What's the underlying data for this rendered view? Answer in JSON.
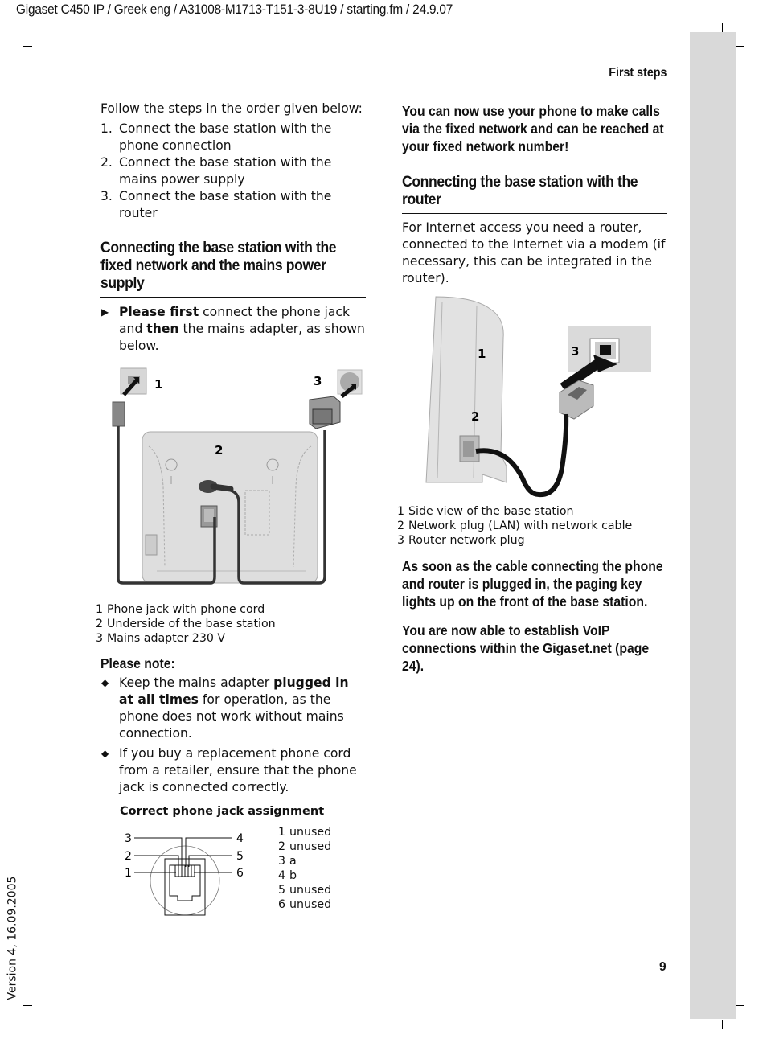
{
  "header": {
    "doc_line": "Gigaset C450 IP / Greek eng / A31008-M1713-T151-3-8U19 / starting.fm / 24.9.07",
    "running_head": "First steps",
    "page_number": "9",
    "version": "Version 4, 16.09.2005"
  },
  "left": {
    "intro": "Follow the steps in the order given below:",
    "steps": [
      {
        "num": "1.",
        "text": "Connect the base station with the phone connection"
      },
      {
        "num": "2.",
        "text": "Connect the base station with the mains power supply"
      },
      {
        "num": "3.",
        "text": "Connect the base station with the router"
      }
    ],
    "section_heading": "Connecting the base station with the fixed network and the mains power supply",
    "instruction": {
      "marker": "▶",
      "bold1": "Please first",
      "text1": " connect the phone jack and ",
      "bold2": "then",
      "text2": " the mains adapter, as shown below."
    },
    "figure_labels": {
      "one": "1",
      "two": "2",
      "three": "3"
    },
    "figure_caption": [
      {
        "num": "1",
        "text": "Phone jack with phone cord"
      },
      {
        "num": "2",
        "text": "Underside of the base station"
      },
      {
        "num": "3",
        "text": "Mains adapter 230 V"
      }
    ],
    "note_heading": "Please note:",
    "notes": [
      {
        "marker": "◆",
        "pre": "Keep the mains adapter ",
        "bold": "plugged in at all times",
        "post": " for operation, as the phone does not work without mains connec­tion."
      },
      {
        "marker": "◆",
        "pre": "If you buy a replacement phone cord from a retailer, ensure that the phone jack is connected correctly.",
        "bold": "",
        "post": ""
      }
    ],
    "jack_title": "Correct phone jack assignment",
    "jack_pin_labels": [
      "1",
      "2",
      "3",
      "4",
      "5",
      "6"
    ],
    "jack_assignment": [
      {
        "num": "1",
        "text": "unused"
      },
      {
        "num": "2",
        "text": "unused"
      },
      {
        "num": "3",
        "text": "a"
      },
      {
        "num": "4",
        "text": "b"
      },
      {
        "num": "5",
        "text": "unused"
      },
      {
        "num": "6",
        "text": "unused"
      }
    ]
  },
  "right": {
    "fixed_network_note": "You can now use your phone to make calls via the fixed network and can be reached at your fixed network number!",
    "section_heading": "Connecting the base station with the router",
    "intro": "For Internet access you need a router, connected to the Internet via a modem (if necessary, this can be integrated in the router).",
    "figure_labels": {
      "one": "1",
      "two": "2",
      "three": "3"
    },
    "figure_caption": [
      {
        "num": "1",
        "text": "Side view of the base station"
      },
      {
        "num": "2",
        "text": "Network plug (LAN) with network cable"
      },
      {
        "num": "3",
        "text": "Router network plug"
      }
    ],
    "paging_note": "As soon as the cable connecting the phone and router is plugged in, the paging key lights up on the front of the base station.",
    "voip_note": "You are now able to establish VoIP connections within the Gigaset.net (page 24)."
  }
}
